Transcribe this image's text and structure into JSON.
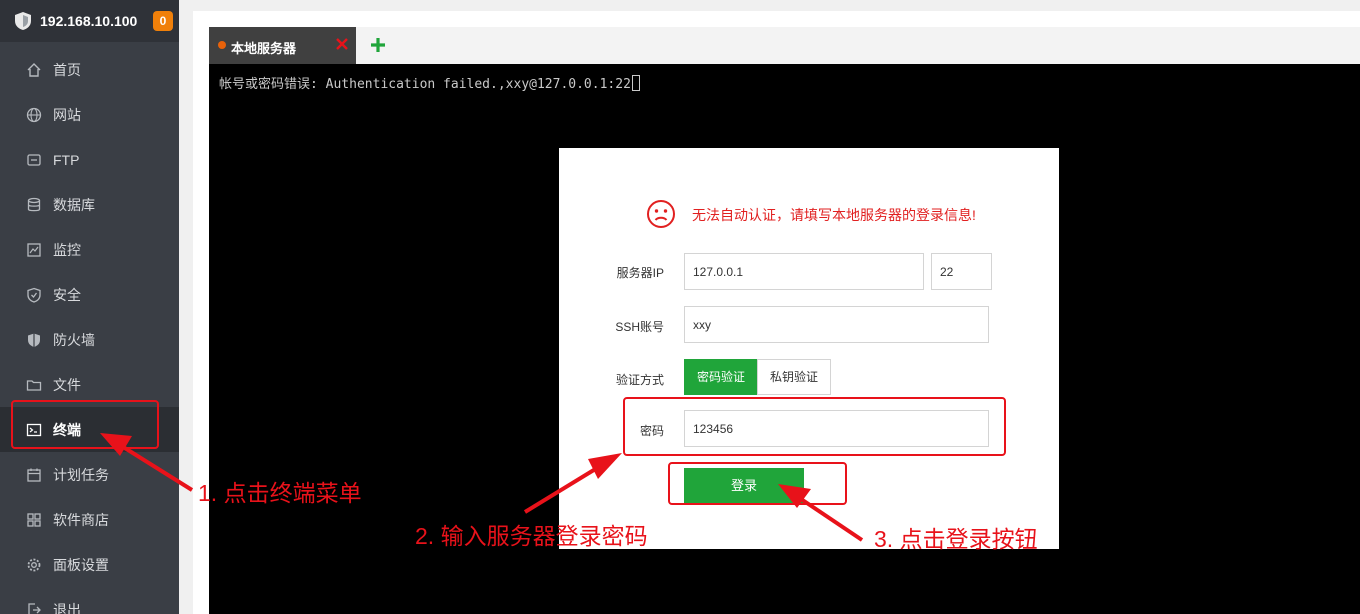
{
  "header": {
    "ip": "192.168.10.100",
    "badge": "0"
  },
  "sidebar": {
    "items": [
      {
        "label": "首页",
        "icon": "home-icon"
      },
      {
        "label": "网站",
        "icon": "globe-icon"
      },
      {
        "label": "FTP",
        "icon": "ftp-icon"
      },
      {
        "label": "数据库",
        "icon": "database-icon"
      },
      {
        "label": "监控",
        "icon": "monitor-icon"
      },
      {
        "label": "安全",
        "icon": "shield-icon"
      },
      {
        "label": "防火墙",
        "icon": "firewall-icon"
      },
      {
        "label": "文件",
        "icon": "folder-icon"
      },
      {
        "label": "终端",
        "icon": "terminal-icon",
        "active": true
      },
      {
        "label": "计划任务",
        "icon": "calendar-icon"
      },
      {
        "label": "软件商店",
        "icon": "apps-icon"
      },
      {
        "label": "面板设置",
        "icon": "gear-icon"
      },
      {
        "label": "退出",
        "icon": "logout-icon"
      }
    ]
  },
  "tabs": [
    {
      "label": "本地服务器"
    }
  ],
  "terminal": {
    "line": "帐号或密码错误: Authentication failed.,xxy@127.0.0.1:22"
  },
  "dialog": {
    "message": "无法自动认证，请填写本地服务器的登录信息!",
    "ip_label": "服务器IP",
    "ip_value": "127.0.0.1",
    "port_value": "22",
    "ssh_label": "SSH账号",
    "ssh_value": "xxy",
    "auth_label": "验证方式",
    "auth_password": "密码验证",
    "auth_key": "私钥验证",
    "pwd_label": "密码",
    "pwd_value": "123456",
    "login_label": "登录"
  },
  "annotations": {
    "step1": "1. 点击终端菜单",
    "step2": "2. 输入服务器登录密码",
    "step3": "3. 点击登录按钮"
  },
  "colors": {
    "accent": "#20a53a",
    "annotation": "#e8121a",
    "sidebar": "#3a3e45",
    "badge": "#f0800a"
  }
}
